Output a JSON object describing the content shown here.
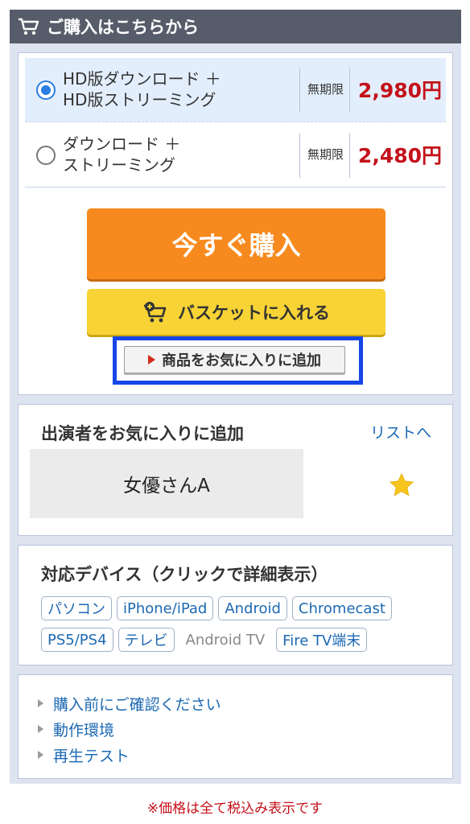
{
  "header": {
    "title": "ご購入はこちらから",
    "icon": "cart-icon"
  },
  "plans": [
    {
      "line1": "HD版ダウンロード ＋",
      "line2": "HD版ストリーミング",
      "term": "無期限",
      "price": "2,980円",
      "selected": true
    },
    {
      "line1": "ダウンロード ＋",
      "line2": "ストリーミング",
      "term": "無期限",
      "price": "2,480円",
      "selected": false
    }
  ],
  "buttons": {
    "buy_now": "今すぐ購入",
    "add_basket": "バスケットに入れる",
    "add_favorite": "商品をお気に入りに追加"
  },
  "performer": {
    "title": "出演者をお気に入りに追加",
    "list_link": "リストへ",
    "name": "女優さんA",
    "icon": "star-icon"
  },
  "devices": {
    "title": "対応デバイス（クリックで詳細表示）",
    "row1": [
      "パソコン",
      "iPhone/iPad",
      "Android",
      "Chromecast"
    ],
    "row2": [
      "PS5/PS4",
      "テレビ",
      "Android TV",
      "Fire TV端末"
    ]
  },
  "links": [
    "購入前にご確認ください",
    "動作環境",
    "再生テスト"
  ],
  "footnote": "※価格は全て税込み表示です",
  "colors": {
    "accent_orange": "#f78a1e",
    "accent_yellow": "#f7d336",
    "price_red": "#c4111a",
    "link_blue": "#1c69b3",
    "highlight_blue": "#1646e6"
  }
}
